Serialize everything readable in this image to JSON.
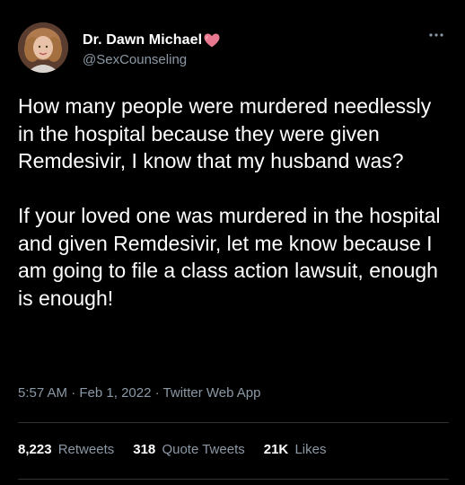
{
  "author": {
    "display_name": "Dr. Dawn Michael",
    "handle": "@SexCounseling",
    "name_emoji": "heart-icon"
  },
  "tweet": {
    "text": "How many people were murdered needlessly in the hospital because they were given Remdesivir, I know that my husband was?\n\nIf your loved one was murdered in the hospital and given Remdesivir, let me know because I am going to file a class action lawsuit, enough is enough!",
    "time": "5:57 AM",
    "separator": "·",
    "date": "Feb 1, 2022",
    "source": "Twitter Web App"
  },
  "stats": {
    "retweets_count": "8,223",
    "retweets_label": "Retweets",
    "quotes_count": "318",
    "quotes_label": "Quote Tweets",
    "likes_count": "21K",
    "likes_label": "Likes"
  },
  "colors": {
    "background": "#000000",
    "primary_text": "#ffffff",
    "secondary_text": "#8b98a5",
    "heart": "#e8788f",
    "divider": "#2f3336"
  }
}
